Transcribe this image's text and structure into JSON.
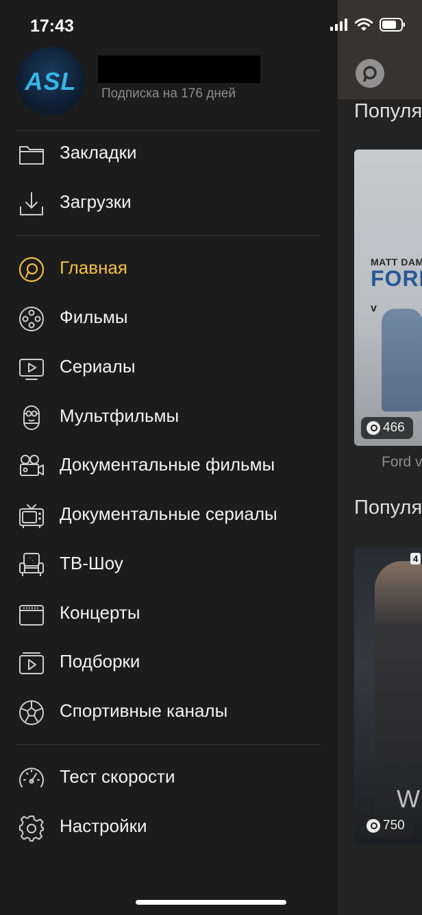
{
  "status_bar": {
    "time": "17:43"
  },
  "profile": {
    "avatar_text": "ASL",
    "subscription": "Подписка на 176 дней"
  },
  "menu": {
    "group1": [
      {
        "label": "Закладки",
        "icon": "folder-icon"
      },
      {
        "label": "Загрузки",
        "icon": "download-icon"
      }
    ],
    "group2": [
      {
        "label": "Главная",
        "icon": "home-logo-icon",
        "active": true
      },
      {
        "label": "Фильмы",
        "icon": "film-reel-icon"
      },
      {
        "label": "Сериалы",
        "icon": "tv-play-icon"
      },
      {
        "label": "Мультфильмы",
        "icon": "minion-icon"
      },
      {
        "label": "Документальные фильмы",
        "icon": "camera-icon"
      },
      {
        "label": "Документальные сериалы",
        "icon": "retro-tv-icon"
      },
      {
        "label": "ТВ-Шоу",
        "icon": "armchair-icon"
      },
      {
        "label": "Концерты",
        "icon": "amplifier-icon"
      },
      {
        "label": "Подборки",
        "icon": "collection-icon"
      },
      {
        "label": "Спортивные каналы",
        "icon": "soccer-ball-icon"
      }
    ],
    "group3": [
      {
        "label": "Тест скорости",
        "icon": "speedometer-icon"
      },
      {
        "label": "Настройки",
        "icon": "gear-icon"
      }
    ]
  },
  "background": {
    "section1_title": "Популя",
    "section2_title": "Популя",
    "poster1": {
      "top_text": "MATT DAMON",
      "title_text": "FORD",
      "title_v": "v",
      "rating": "466",
      "caption": "Ford v"
    },
    "poster2": {
      "tag": "4",
      "letter": "W",
      "rating": "750"
    }
  },
  "colors": {
    "accent": "#f5c042",
    "drawer_bg": "#1c1c1d",
    "text": "#f2f2f2",
    "muted": "#8c8c8c"
  }
}
